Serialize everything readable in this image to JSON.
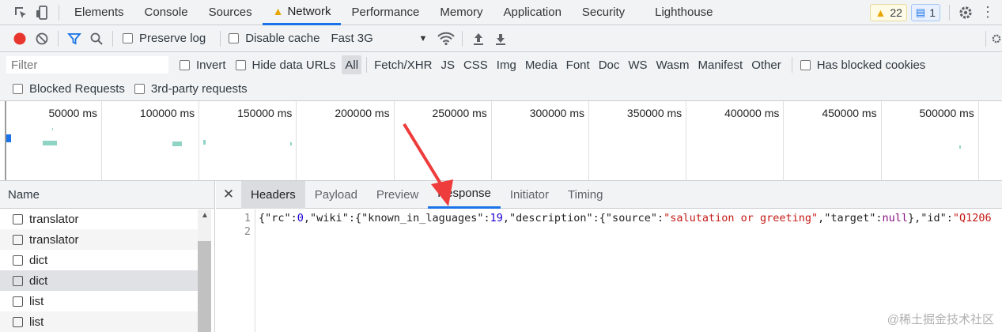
{
  "top_tabs": [
    "Elements",
    "Console",
    "Sources",
    "Network",
    "Performance",
    "Memory",
    "Application",
    "Security",
    "Lighthouse"
  ],
  "active_tab": "Network",
  "warnings_count": "22",
  "messages_count": "1",
  "toolbar": {
    "preserve_log": "Preserve log",
    "disable_cache": "Disable cache",
    "throttle": "Fast 3G"
  },
  "filter": {
    "placeholder": "Filter",
    "invert": "Invert",
    "hide_data_urls": "Hide data URLs",
    "types": [
      "All",
      "Fetch/XHR",
      "JS",
      "CSS",
      "Img",
      "Media",
      "Font",
      "Doc",
      "WS",
      "Wasm",
      "Manifest",
      "Other"
    ],
    "has_blocked_cookies": "Has blocked cookies",
    "blocked_requests": "Blocked Requests",
    "third_party": "3rd-party requests"
  },
  "timeline_ticks": [
    "50000 ms",
    "100000 ms",
    "150000 ms",
    "200000 ms",
    "250000 ms",
    "300000 ms",
    "350000 ms",
    "400000 ms",
    "450000 ms",
    "500000 ms"
  ],
  "requests": {
    "header": "Name",
    "items": [
      "translator",
      "translator",
      "dict",
      "dict",
      "list",
      "list"
    ]
  },
  "detail_tabs": [
    "Headers",
    "Payload",
    "Preview",
    "Response",
    "Initiator",
    "Timing"
  ],
  "active_detail_tab": "Response",
  "response": {
    "line_numbers": [
      "1",
      "2"
    ],
    "tokens": [
      {
        "t": "{\"rc\":",
        "c": ""
      },
      {
        "t": "0",
        "c": "n"
      },
      {
        "t": ",\"wiki\":{\"known_in_laguages\":",
        "c": ""
      },
      {
        "t": "19",
        "c": "n"
      },
      {
        "t": ",\"description\":{\"source\":",
        "c": ""
      },
      {
        "t": "\"salutation or greeting\"",
        "c": "s"
      },
      {
        "t": ",\"target\":",
        "c": ""
      },
      {
        "t": "null",
        "c": "k"
      },
      {
        "t": "},\"id\":",
        "c": ""
      },
      {
        "t": "\"Q1206",
        "c": "s"
      }
    ]
  },
  "watermark": "@稀土掘金技术社区",
  "colors": {
    "accent": "#1a73e8",
    "annotation_arrow": "#ee3b3b"
  }
}
